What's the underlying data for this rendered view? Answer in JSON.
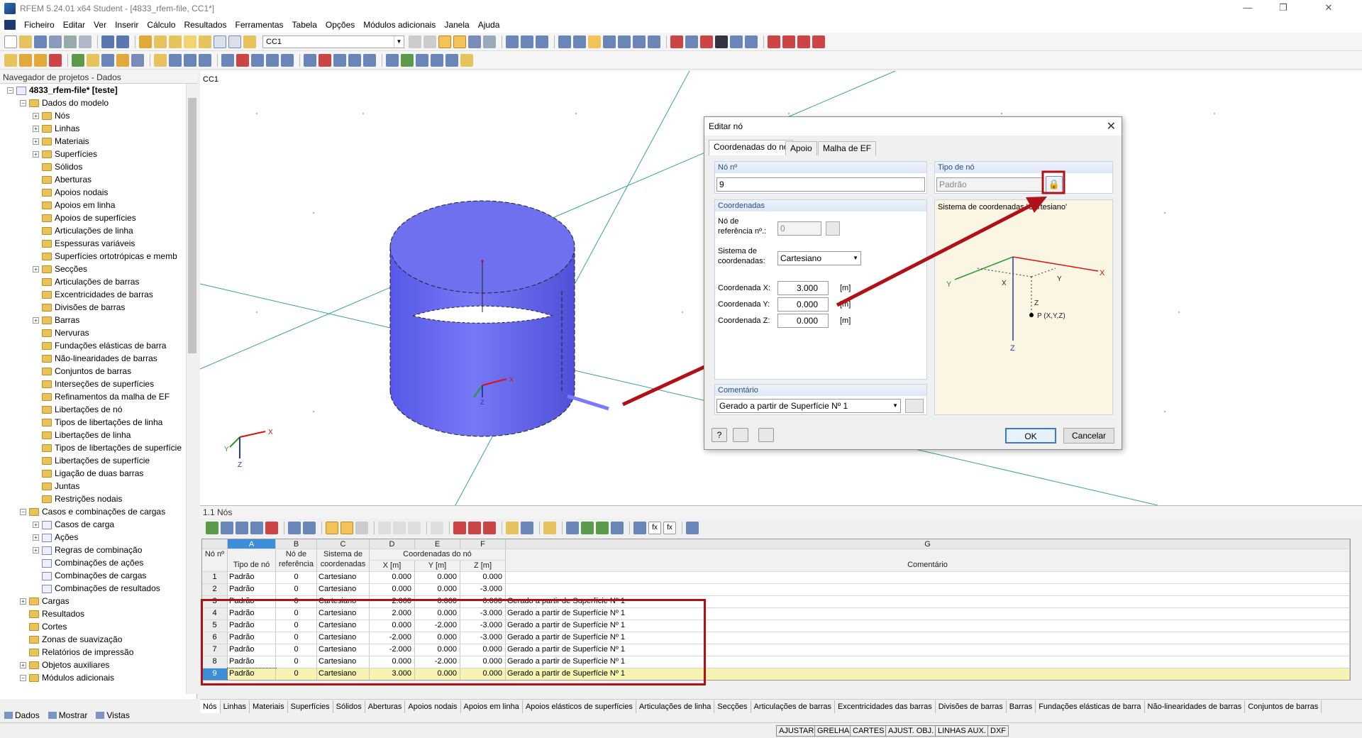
{
  "window": {
    "title": "RFEM 5.24.01 x64 Student - [4833_rfem-file, CC1*]",
    "controls": [
      "—",
      "❒",
      "✕"
    ]
  },
  "menu": [
    "Ficheiro",
    "Editar",
    "Ver",
    "Inserir",
    "Cálculo",
    "Resultados",
    "Ferramentas",
    "Tabela",
    "Opções",
    "Módulos adicionais",
    "Janela",
    "Ajuda"
  ],
  "toolbar": {
    "loadcase": "CC1"
  },
  "navigator": {
    "title": "Navegador de projetos - Dados",
    "items": [
      {
        "label": "4833_rfem-file* [teste]",
        "level": 0,
        "exp": "−",
        "icon": "doc",
        "bold": true
      },
      {
        "label": "Dados do modelo",
        "level": 1,
        "exp": "−",
        "icon": "fold"
      },
      {
        "label": "Nós",
        "level": 2,
        "exp": "+",
        "icon": "fold"
      },
      {
        "label": "Linhas",
        "level": 2,
        "exp": "+",
        "icon": "fold"
      },
      {
        "label": "Materiais",
        "level": 2,
        "exp": "+",
        "icon": "fold"
      },
      {
        "label": "Superfícies",
        "level": 2,
        "exp": "+",
        "icon": "fold"
      },
      {
        "label": "Sólidos",
        "level": 2,
        "exp": "",
        "icon": "fold"
      },
      {
        "label": "Aberturas",
        "level": 2,
        "exp": "",
        "icon": "fold"
      },
      {
        "label": "Apoios nodais",
        "level": 2,
        "exp": "",
        "icon": "fold"
      },
      {
        "label": "Apoios em linha",
        "level": 2,
        "exp": "",
        "icon": "fold"
      },
      {
        "label": "Apoios de superfícies",
        "level": 2,
        "exp": "",
        "icon": "fold"
      },
      {
        "label": "Articulações de linha",
        "level": 2,
        "exp": "",
        "icon": "fold"
      },
      {
        "label": "Espessuras variáveis",
        "level": 2,
        "exp": "",
        "icon": "fold"
      },
      {
        "label": "Superfícies ortotrópicas e memb",
        "level": 2,
        "exp": "",
        "icon": "fold"
      },
      {
        "label": "Secções",
        "level": 2,
        "exp": "+",
        "icon": "fold"
      },
      {
        "label": "Articulações de barras",
        "level": 2,
        "exp": "",
        "icon": "fold"
      },
      {
        "label": "Excentricidades de barras",
        "level": 2,
        "exp": "",
        "icon": "fold"
      },
      {
        "label": "Divisões de barras",
        "level": 2,
        "exp": "",
        "icon": "fold"
      },
      {
        "label": "Barras",
        "level": 2,
        "exp": "+",
        "icon": "fold"
      },
      {
        "label": "Nervuras",
        "level": 2,
        "exp": "",
        "icon": "fold"
      },
      {
        "label": "Fundações elásticas de barra",
        "level": 2,
        "exp": "",
        "icon": "fold"
      },
      {
        "label": "Não-linearidades de barras",
        "level": 2,
        "exp": "",
        "icon": "fold"
      },
      {
        "label": "Conjuntos de barras",
        "level": 2,
        "exp": "",
        "icon": "fold"
      },
      {
        "label": "Interseções de superfícies",
        "level": 2,
        "exp": "",
        "icon": "fold"
      },
      {
        "label": "Refinamentos da malha de EF",
        "level": 2,
        "exp": "",
        "icon": "fold"
      },
      {
        "label": "Libertações de nó",
        "level": 2,
        "exp": "",
        "icon": "fold"
      },
      {
        "label": "Tipos de libertações de linha",
        "level": 2,
        "exp": "",
        "icon": "fold"
      },
      {
        "label": "Libertações de linha",
        "level": 2,
        "exp": "",
        "icon": "fold"
      },
      {
        "label": "Tipos de libertações de superfície",
        "level": 2,
        "exp": "",
        "icon": "fold"
      },
      {
        "label": "Libertações de superfície",
        "level": 2,
        "exp": "",
        "icon": "fold"
      },
      {
        "label": "Ligação de duas barras",
        "level": 2,
        "exp": "",
        "icon": "fold"
      },
      {
        "label": "Juntas",
        "level": 2,
        "exp": "",
        "icon": "fold"
      },
      {
        "label": "Restrições nodais",
        "level": 2,
        "exp": "",
        "icon": "fold"
      },
      {
        "label": "Casos e combinações de cargas",
        "level": 1,
        "exp": "−",
        "icon": "fold"
      },
      {
        "label": "Casos de carga",
        "level": 2,
        "exp": "+",
        "icon": "doc"
      },
      {
        "label": "Ações",
        "level": 2,
        "exp": "+",
        "icon": "doc"
      },
      {
        "label": "Regras de combinação",
        "level": 2,
        "exp": "+",
        "icon": "doc"
      },
      {
        "label": "Combinações de ações",
        "level": 2,
        "exp": "",
        "icon": "doc"
      },
      {
        "label": "Combinações de cargas",
        "level": 2,
        "exp": "",
        "icon": "doc"
      },
      {
        "label": "Combinações de resultados",
        "level": 2,
        "exp": "",
        "icon": "doc"
      },
      {
        "label": "Cargas",
        "level": 1,
        "exp": "+",
        "icon": "fold"
      },
      {
        "label": "Resultados",
        "level": 1,
        "exp": "",
        "icon": "fold"
      },
      {
        "label": "Cortes",
        "level": 1,
        "exp": "",
        "icon": "fold"
      },
      {
        "label": "Zonas de suavização",
        "level": 1,
        "exp": "",
        "icon": "fold"
      },
      {
        "label": "Relatórios de impressão",
        "level": 1,
        "exp": "",
        "icon": "fold"
      },
      {
        "label": "Objetos auxiliares",
        "level": 1,
        "exp": "+",
        "icon": "fold"
      },
      {
        "label": "Módulos adicionais",
        "level": 1,
        "exp": "−",
        "icon": "fold"
      }
    ],
    "tabs": [
      "Dados",
      "Mostrar",
      "Vistas"
    ]
  },
  "viewport": {
    "label": "CC1",
    "axes": {
      "x": "X",
      "y": "Y",
      "z": "Z"
    }
  },
  "dialog": {
    "title": "Editar nó",
    "tabs": [
      "Coordenadas do nó",
      "Apoio",
      "Malha de EF"
    ],
    "node_no_label": "Nó nº",
    "node_no_value": "9",
    "node_type_label": "Tipo de nó",
    "node_type_value": "Padrão",
    "coords_section": "Coordenadas",
    "ref_node_label": "Nó de referência nº.:",
    "ref_node_label_a": "Nó de",
    "ref_node_label_b": "referência nº.:",
    "ref_node_value": "0",
    "coord_sys_label_a": "Sistema de",
    "coord_sys_label_b": "coordenadas:",
    "coord_sys_value": "Cartesiano",
    "coord_x_label": "Coordenada X:",
    "coord_x_value": "3.000",
    "coord_y_label": "Coordenada Y:",
    "coord_y_value": "0.000",
    "coord_z_label": "Coordenada Z:",
    "coord_z_value": "0.000",
    "unit": "[m]",
    "diagram_caption": "Sistema de coordenadas 'Cartesiano'",
    "diagram_labels": {
      "x": "X",
      "y": "Y",
      "z": "Z",
      "p": "P (X,Y,Z)"
    },
    "comment_label": "Comentário",
    "comment_value": "Gerado a partir de Superfície Nº 1",
    "ok": "OK",
    "cancel": "Cancelar"
  },
  "table": {
    "title": "1.1 Nós",
    "letters": [
      "A",
      "B",
      "C",
      "D",
      "E",
      "F",
      "G"
    ],
    "header": {
      "node_no": "Nó nº",
      "node_type": "Tipo de nó",
      "ref_node": "Nó de referência",
      "coord_sys": "Sistema de coordenadas",
      "coords_group": "Coordenadas do nó",
      "x": "X [m]",
      "y": "Y [m]",
      "z": "Z [m]",
      "comment": "Comentário"
    },
    "rows": [
      {
        "no": "1",
        "type": "Padrão",
        "ref": "0",
        "sys": "Cartesiano",
        "x": "0.000",
        "y": "0.000",
        "z": "0.000",
        "comment": ""
      },
      {
        "no": "2",
        "type": "Padrão",
        "ref": "0",
        "sys": "Cartesiano",
        "x": "0.000",
        "y": "0.000",
        "z": "-3.000",
        "comment": ""
      },
      {
        "no": "3",
        "type": "Padrão",
        "ref": "0",
        "sys": "Cartesiano",
        "x": "2.000",
        "y": "0.000",
        "z": "0.000",
        "comment": "Gerado a partir de Superfície Nº 1"
      },
      {
        "no": "4",
        "type": "Padrão",
        "ref": "0",
        "sys": "Cartesiano",
        "x": "2.000",
        "y": "0.000",
        "z": "-3.000",
        "comment": "Gerado a partir de Superfície Nº 1"
      },
      {
        "no": "5",
        "type": "Padrão",
        "ref": "0",
        "sys": "Cartesiano",
        "x": "0.000",
        "y": "-2.000",
        "z": "-3.000",
        "comment": "Gerado a partir de Superfície Nº 1"
      },
      {
        "no": "6",
        "type": "Padrão",
        "ref": "0",
        "sys": "Cartesiano",
        "x": "-2.000",
        "y": "0.000",
        "z": "-3.000",
        "comment": "Gerado a partir de Superfície Nº 1"
      },
      {
        "no": "7",
        "type": "Padrão",
        "ref": "0",
        "sys": "Cartesiano",
        "x": "-2.000",
        "y": "0.000",
        "z": "0.000",
        "comment": "Gerado a partir de Superfície Nº 1"
      },
      {
        "no": "8",
        "type": "Padrão",
        "ref": "0",
        "sys": "Cartesiano",
        "x": "0.000",
        "y": "-2.000",
        "z": "0.000",
        "comment": "Gerado a partir de Superfície Nº 1"
      },
      {
        "no": "9",
        "type": "Padrão",
        "ref": "0",
        "sys": "Cartesiano",
        "x": "3.000",
        "y": "0.000",
        "z": "0.000",
        "comment": "Gerado a partir de Superfície Nº 1"
      },
      {
        "no": "10",
        "type": "",
        "ref": "",
        "sys": "",
        "x": "",
        "y": "",
        "z": "",
        "comment": ""
      }
    ],
    "tabs": [
      "Nós",
      "Linhas",
      "Materiais",
      "Superfícies",
      "Sólidos",
      "Aberturas",
      "Apoios nodais",
      "Apoios em linha",
      "Apoios elásticos de superfícies",
      "Articulações de linha",
      "Secções",
      "Articulações de barras",
      "Excentricidades das barras",
      "Divisões de barras",
      "Barras",
      "Fundações elásticas de barra",
      "Não-linearidades de barras",
      "Conjuntos de barras"
    ]
  },
  "status": [
    "AJUSTAR",
    "GRELHA",
    "CARTES",
    "AJUST. OBJ.",
    "LINHAS AUX.",
    "DXF"
  ],
  "colors": {
    "accent_red": "#b01116",
    "cylinder": "#6f70f0",
    "selection": "#3d8ed9"
  }
}
